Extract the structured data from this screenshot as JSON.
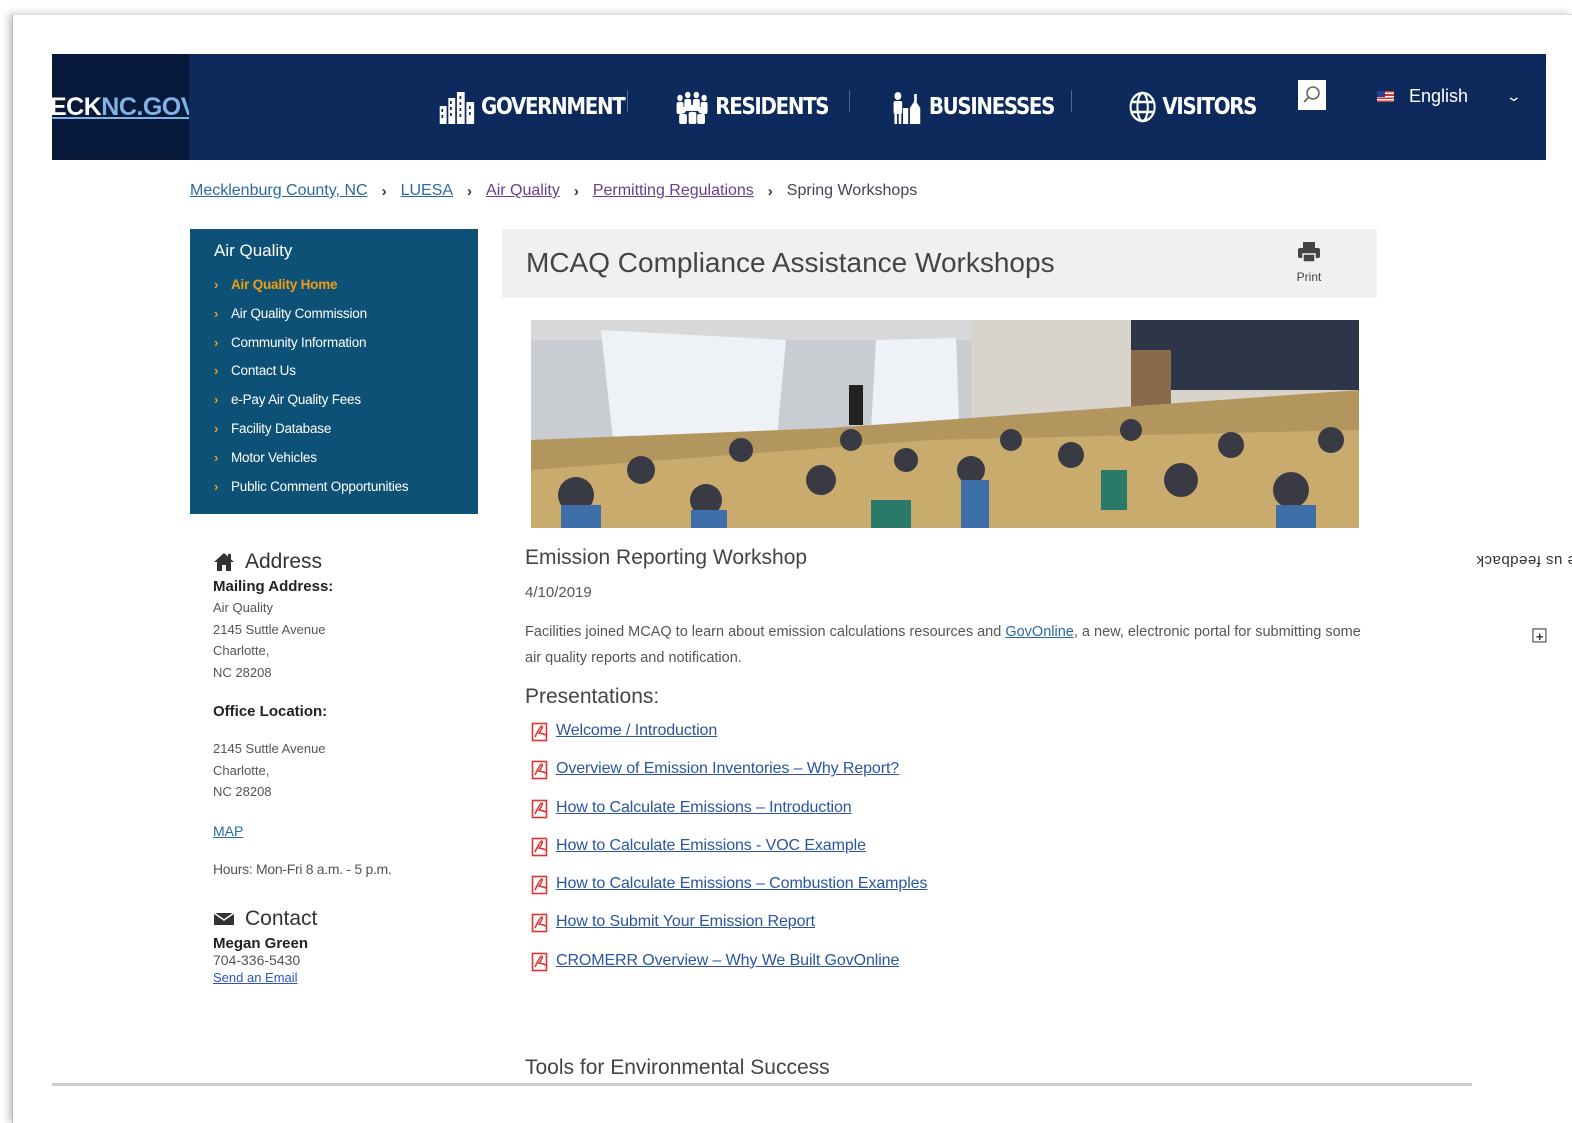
{
  "header": {
    "logo_part1": "ECK",
    "logo_part2": "NC.GOV",
    "nav": [
      {
        "label": "GOVERNMENT",
        "icon": "government-icon"
      },
      {
        "label": "RESIDENTS",
        "icon": "residents-icon"
      },
      {
        "label": "BUSINESSES",
        "icon": "businesses-icon"
      },
      {
        "label": "VISITORS",
        "icon": "globe-icon"
      }
    ],
    "language": "English"
  },
  "breadcrumb": {
    "items": [
      "Mecklenburg County, NC",
      "LUESA",
      "Air Quality",
      "Permitting Regulations"
    ],
    "current": "Spring Workshops"
  },
  "sidebar": {
    "title": "Air Quality",
    "items": [
      "Air Quality Home",
      "Air Quality Commission",
      "Community Information",
      "Contact Us",
      "e-Pay Air Quality Fees",
      "Facility Database",
      "Motor Vehicles",
      "Public Comment Opportunities"
    ]
  },
  "address": {
    "heading": "Address",
    "mailing_label": "Mailing Address:",
    "mailing": [
      "Air Quality",
      "2145 Suttle Avenue",
      "Charlotte,",
      "NC 28208"
    ],
    "office_label": "Office Location:",
    "office": [
      "2145 Suttle Avenue",
      "Charlotte,",
      "NC 28208"
    ],
    "map": "MAP",
    "hours": "Hours: Mon-Fri  8 a.m. - 5 p.m."
  },
  "contact": {
    "heading": "Contact",
    "name": "Megan Green",
    "phone": "704-336-5430",
    "email": "Send an Email"
  },
  "main": {
    "title": "MCAQ Compliance Assistance Workshops",
    "print": "Print",
    "section_title": "Emission Reporting Workshop",
    "date": "4/10/2019",
    "desc_before": "Facilities joined MCAQ to learn about emission calculations resources and ",
    "desc_link": "GovOnline",
    "desc_after": ", a new, electronic portal for submitting some air quality reports and notification.",
    "presentations_heading": "Presentations:",
    "presentations": [
      "Welcome / Introduction",
      "Overview of Emission Inventories – Why Report?",
      "How to Calculate Emissions – Introduction",
      "How to Calculate Emissions - VOC Example",
      "How to Calculate Emissions – Combustion Examples",
      "How to Submit Your Emission Report",
      "CROMERR Overview – Why We Built GovOnline"
    ],
    "next_section": "Tools for Environmental Success"
  },
  "feedback": "Give us feedback",
  "colors": {
    "header": "#0e2a5c",
    "sidebar": "#0d5176",
    "accent": "#f39c12",
    "link": "#2a55a0"
  }
}
